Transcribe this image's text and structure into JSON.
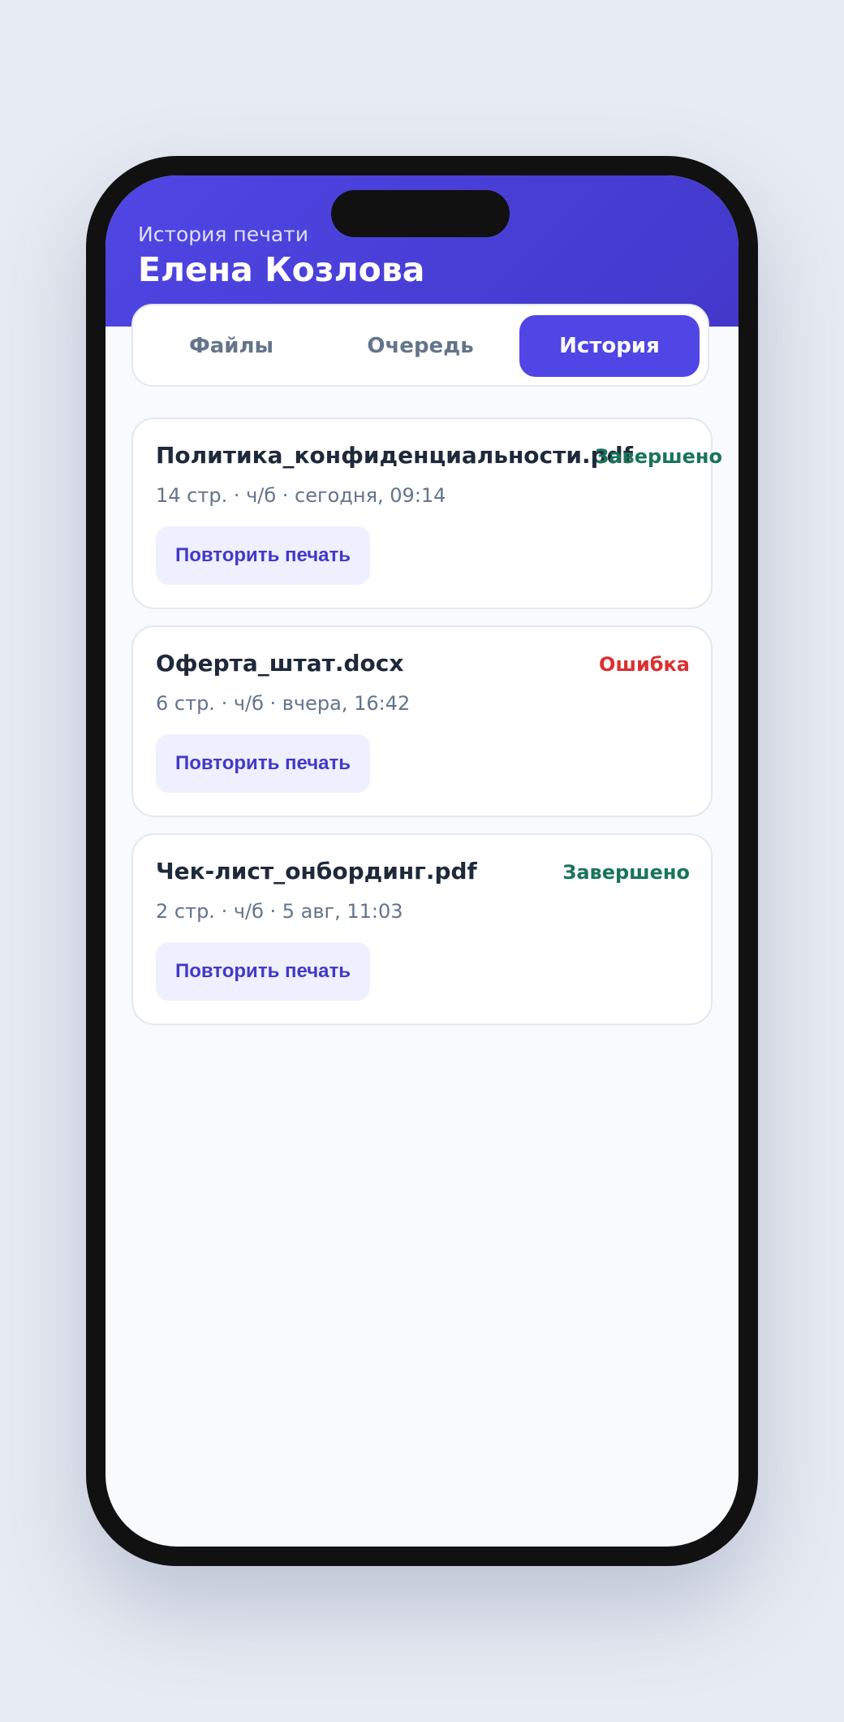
{
  "header": {
    "subtitle": "История печати",
    "user_name": "Елена Козлова"
  },
  "tabs": [
    {
      "label": "Файлы",
      "active": false
    },
    {
      "label": "Очередь",
      "active": false
    },
    {
      "label": "История",
      "active": true
    }
  ],
  "history": [
    {
      "file_name": "Политика_конфиденциальности.pdf",
      "status": "Завершено",
      "status_kind": "success",
      "meta": "14 стр. · ч/б · сегодня, 09:14",
      "action_label": "Повторить печать"
    },
    {
      "file_name": "Оферта_штат.docx",
      "status": "Ошибка",
      "status_kind": "error",
      "meta": "6 стр. · ч/б · вчера, 16:42",
      "action_label": "Повторить печать"
    },
    {
      "file_name": "Чек-лист_онбординг.pdf",
      "status": "Завершено",
      "status_kind": "success",
      "meta": "2 стр. · ч/б · 5 авг, 11:03",
      "action_label": "Повторить печать"
    }
  ],
  "colors": {
    "accent": "#4f46e5",
    "success": "#18755a",
    "error": "#dc2f2f",
    "muted_text": "#64748b"
  }
}
